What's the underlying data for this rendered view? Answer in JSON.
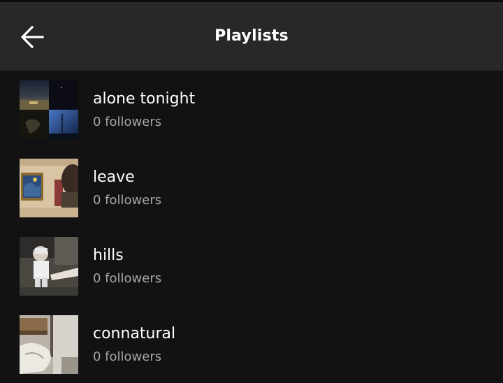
{
  "header": {
    "title": "Playlists",
    "back_icon": "arrow-left-icon"
  },
  "playlists": [
    {
      "name": "alone tonight",
      "followers": "0 followers"
    },
    {
      "name": "leave",
      "followers": "0 followers"
    },
    {
      "name": "hills",
      "followers": "0 followers"
    },
    {
      "name": "connatural",
      "followers": "0 followers"
    }
  ],
  "colors": {
    "background": "#121212",
    "header": "#282828",
    "primary_text": "#ffffff",
    "secondary_text": "#a7a7a7"
  }
}
